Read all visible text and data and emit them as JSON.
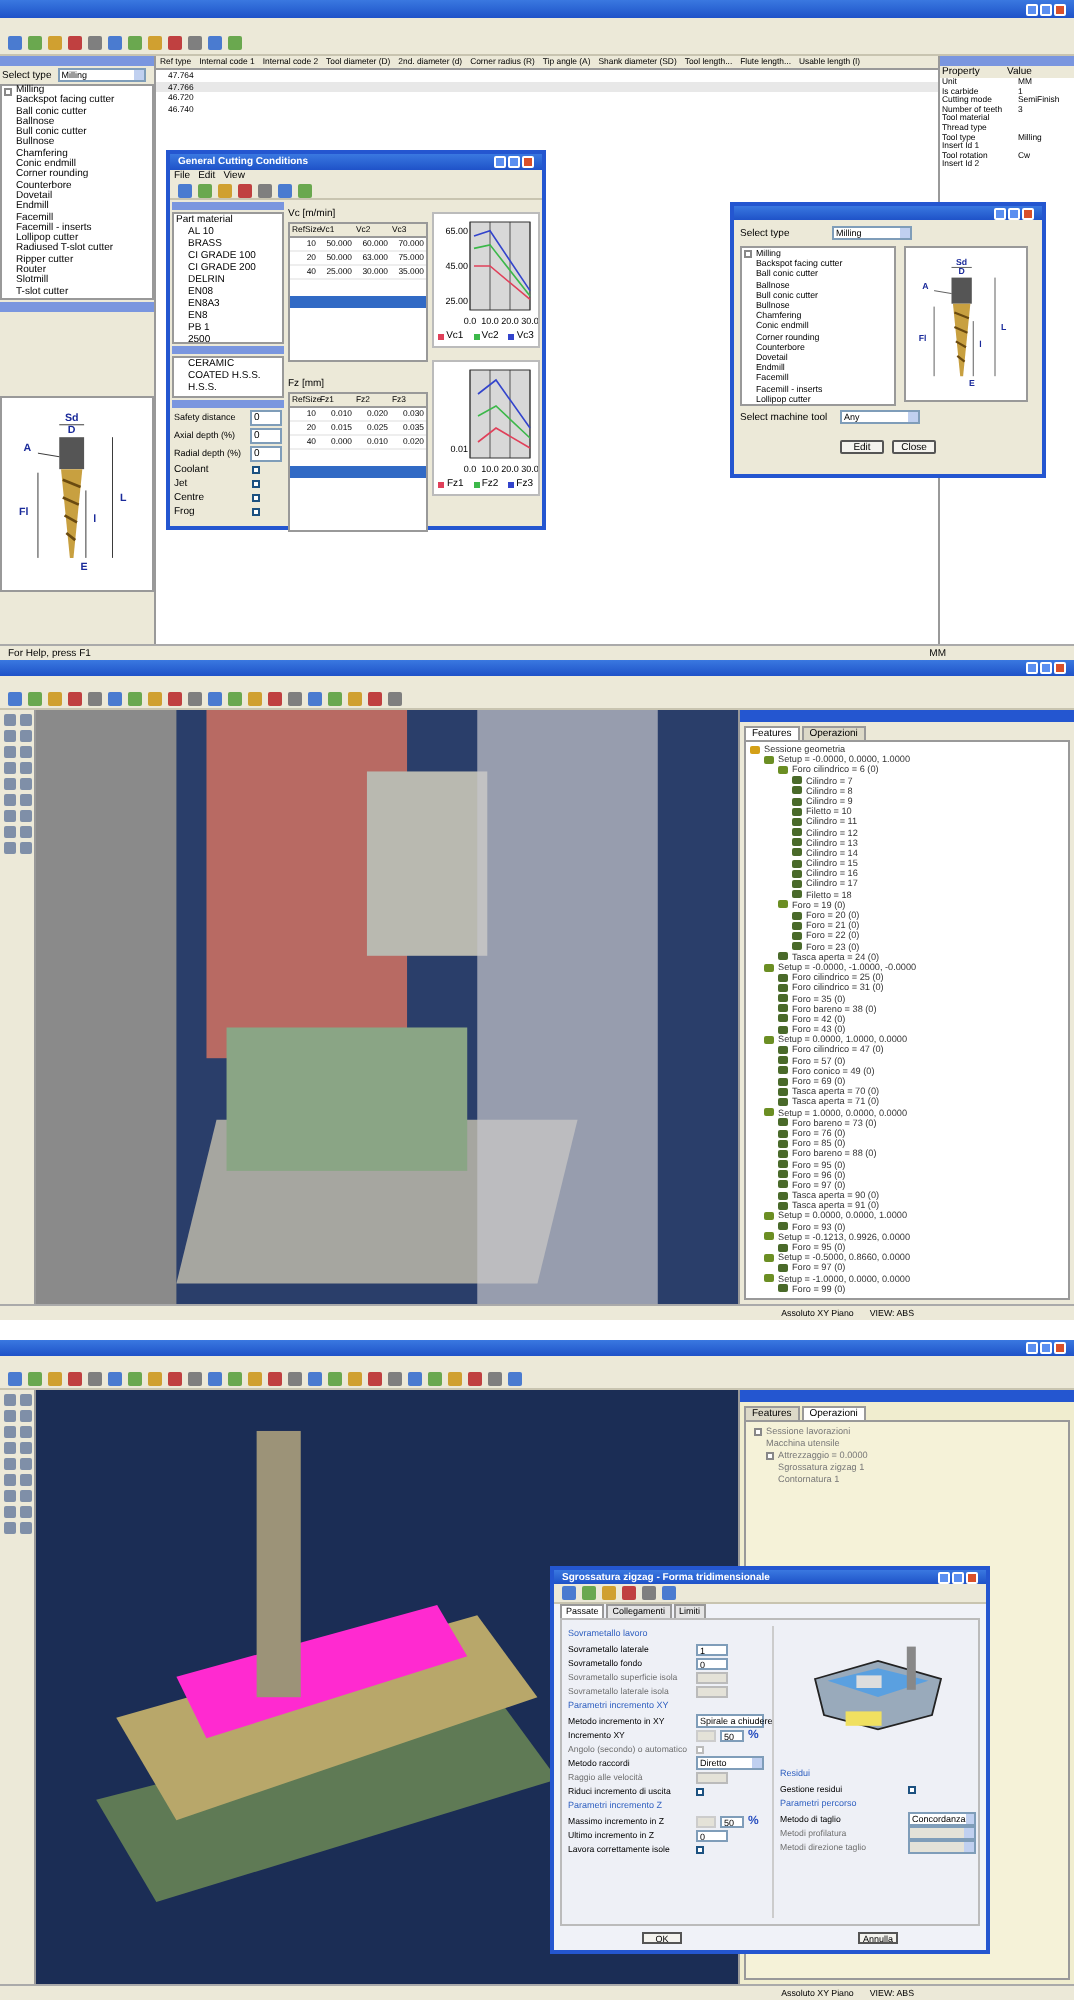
{
  "tool_database": {
    "select_type": {
      "label": "Select type",
      "value": "Milling"
    },
    "tool_types": [
      {
        "label": "Milling",
        "children": [
          {
            "label": "Backspot facing cutter"
          },
          {
            "label": "Ball conic cutter"
          },
          {
            "label": "Ballnose"
          },
          {
            "label": "Bull conic cutter"
          },
          {
            "label": "Bullnose"
          },
          {
            "label": "Chamfering"
          },
          {
            "label": "Conic endmill"
          },
          {
            "label": "Corner rounding"
          },
          {
            "label": "Counterbore"
          },
          {
            "label": "Dovetail"
          },
          {
            "label": "Endmill"
          },
          {
            "label": "Facemill"
          },
          {
            "label": "Facemill - inserts"
          },
          {
            "label": "Lollipop cutter"
          },
          {
            "label": "Radiused T-slot cutter"
          },
          {
            "label": "Ripper cutter"
          },
          {
            "label": "Router"
          },
          {
            "label": "Slotmill"
          },
          {
            "label": "T-slot cutter"
          }
        ]
      }
    ],
    "drawing_labels": [
      "Sd",
      "D",
      "A",
      "Fl",
      "l",
      "L",
      "E"
    ],
    "table": {
      "columns": [
        "Ref type",
        "Internal code 1",
        "Internal code 2",
        "Tool diameter (D)",
        "2nd. diameter (d)",
        "Corner radius (R)",
        "Tip angle (A)",
        "Shank diameter (SD)",
        "Tool length...",
        "Flute length...",
        "Usable length (l)"
      ],
      "rows": [
        {
          "cells": [
            "47.764"
          ],
          "selected": false
        },
        {
          "cells": [
            "47.766"
          ],
          "selected": true
        },
        {
          "cells": [
            "46.720"
          ],
          "selected": false
        },
        {
          "cells": [
            "46.740"
          ],
          "selected": false
        }
      ]
    },
    "properties": {
      "columns": [
        "Property",
        "Value"
      ],
      "rows": [
        [
          "Unit",
          "MM"
        ],
        [
          "Is carbide",
          "1"
        ],
        [
          "Cutting mode",
          "SemiFinish"
        ],
        [
          "Number of teeth",
          "3"
        ],
        [
          "Tool material"
        ],
        [
          "Thread type"
        ],
        [
          "Tool type",
          "Milling"
        ],
        [
          "Insert Id 1"
        ],
        [
          "Tool rotation",
          "Cw"
        ],
        [
          "Insert Id 2"
        ]
      ]
    },
    "status_bar": {
      "help": "For Help, press F1",
      "unit": "MM"
    },
    "cutting_dialog": {
      "title": "General Cutting Conditions",
      "menu": [
        "File",
        "Edit",
        "View"
      ],
      "part_material": {
        "label": "Part material",
        "items": [
          "AL 10",
          "BRASS",
          "CI GRADE 100",
          "CI GRADE 200",
          "DELRIN",
          "EN08",
          "EN8A3",
          "EN8",
          "PB 1",
          "2500"
        ]
      },
      "tool_material": [
        "CERAMIC",
        "COATED H.S.S.",
        "H.S.S."
      ],
      "fields": [
        {
          "label": "Safety distance",
          "value": "0"
        },
        {
          "label": "Axial depth (%)",
          "value": "0"
        },
        {
          "label": "Radial depth (%)",
          "value": "0"
        }
      ],
      "checks": [
        {
          "label": "Coolant",
          "checked": false
        },
        {
          "label": "Jet",
          "checked": false
        },
        {
          "label": "Centre",
          "checked": false
        },
        {
          "label": "Frog",
          "checked": false
        }
      ],
      "tables": [
        {
          "title": "Vc [m/min]",
          "columns": [
            "RefSize",
            "Vc1",
            "Vc2",
            "Vc3"
          ],
          "rows": [
            [
              "10",
              "50.000",
              "60.000",
              "70.000"
            ],
            [
              "20",
              "50.000",
              "63.000",
              "75.000"
            ],
            [
              "40",
              "25.000",
              "30.000",
              "35.000"
            ]
          ]
        },
        {
          "title": "Fz [mm]",
          "columns": [
            "RefSize",
            "Fz1",
            "Fz2",
            "Fz3"
          ],
          "rows": [
            [
              "10",
              "0.010",
              "0.020",
              "0.030"
            ],
            [
              "20",
              "0.015",
              "0.025",
              "0.035"
            ],
            [
              "40",
              "0.000",
              "0.010",
              "0.020"
            ]
          ]
        }
      ],
      "charts": [
        {
          "chart_data": {
            "type": "line",
            "legend": "bottom",
            "x": [
              2,
              10,
              30
            ],
            "xlim": [
              0,
              30
            ],
            "ylim": [
              20,
              70
            ],
            "xticks": [
              {
                "value": 0,
                "label": "0.0"
              },
              {
                "value": 10,
                "label": "10.0"
              },
              {
                "value": 20,
                "label": "20.0"
              },
              {
                "value": 30,
                "label": "30.0"
              }
            ],
            "yticks": [
              {
                "value": 65,
                "label": "65.00"
              },
              {
                "value": 45,
                "label": "45.00"
              },
              {
                "value": 25,
                "label": "25.00"
              }
            ],
            "series": [
              {
                "name": "Vc1",
                "color": "#e0405a",
                "values": [
                  45,
                  45,
                  26
                ]
              },
              {
                "name": "Vc2",
                "color": "#3cb84a",
                "values": [
                  55,
                  57,
                  28
                ]
              },
              {
                "name": "Vc3",
                "color": "#3344cc",
                "values": [
                  62,
                  65,
                  31
                ]
              }
            ]
          }
        }
      ],
      "fz_chart": {
        "x_labels": [
          "0.0",
          "10.0",
          "20.0",
          "30.0"
        ],
        "y_label": "0.01",
        "legend": [
          {
            "name": "Fz1",
            "color": "#e0405a"
          },
          {
            "name": "Fz2",
            "color": "#3cb84a"
          },
          {
            "name": "Fz3",
            "color": "#3344cc"
          }
        ]
      }
    },
    "search_dialog": {
      "select_type": {
        "label": "Select type",
        "value": "Milling"
      },
      "tool_types": [
        {
          "label": "Milling",
          "children": [
            {
              "label": "Backspot facing cutter"
            },
            {
              "label": "Ball conic cutter"
            },
            {
              "label": "Ballnose"
            },
            {
              "label": "Bull conic cutter"
            },
            {
              "label": "Bullnose"
            },
            {
              "label": "Chamfering"
            },
            {
              "label": "Conic endmill"
            },
            {
              "label": "Corner rounding"
            },
            {
              "label": "Counterbore"
            },
            {
              "label": "Dovetail"
            },
            {
              "label": "Endmill"
            },
            {
              "label": "Facemill"
            },
            {
              "label": "Facemill - inserts"
            },
            {
              "label": "Lollipop cutter"
            }
          ]
        }
      ],
      "drawing_labels": [
        "Sd",
        "D",
        "A",
        "Fl",
        "l",
        "L",
        "E"
      ],
      "machine": {
        "label": "Select machine tool",
        "value": "Any"
      },
      "buttons": [
        "Edit",
        "Close"
      ]
    }
  },
  "cam_features": {
    "navigator": {
      "tabs": [
        {
          "label": "Features",
          "selected": true
        },
        {
          "label": "Operazioni",
          "selected": false
        }
      ],
      "tree": [
        {
          "label": "Sessione geometria",
          "children": [
            {
              "label": "Setup = -0.0000, 0.0000, 1.0000",
              "children": [
                {
                  "label": "Foro cilindrico = 6 (0)",
                  "children": [
                    {
                      "label": "Cilindro = 7"
                    },
                    {
                      "label": "Cilindro = 8"
                    },
                    {
                      "label": "Cilindro = 9"
                    },
                    {
                      "label": "Filetto = 10"
                    },
                    {
                      "label": "Cilindro = 11"
                    },
                    {
                      "label": "Cilindro = 12"
                    },
                    {
                      "label": "Cilindro = 13"
                    },
                    {
                      "label": "Cilindro = 14"
                    },
                    {
                      "label": "Cilindro = 15"
                    },
                    {
                      "label": "Cilindro = 16"
                    },
                    {
                      "label": "Cilindro = 17"
                    },
                    {
                      "label": "Filetto = 18"
                    }
                  ]
                },
                {
                  "label": "Foro = 19 (0)",
                  "children": [
                    {
                      "label": "Foro = 20 (0)"
                    },
                    {
                      "label": "Foro = 21 (0)"
                    },
                    {
                      "label": "Foro = 22 (0)"
                    },
                    {
                      "label": "Foro = 23 (0)"
                    }
                  ]
                },
                {
                  "label": "Tasca aperta = 24 (0)"
                }
              ]
            },
            {
              "label": "Setup = -0.0000, -1.0000, -0.0000",
              "children": [
                {
                  "label": "Foro cilindrico = 25 (0)"
                },
                {
                  "label": "Foro cilindrico = 31 (0)"
                },
                {
                  "label": "Foro = 35 (0)"
                },
                {
                  "label": "Foro bareno = 38 (0)"
                },
                {
                  "label": "Foro = 42 (0)"
                },
                {
                  "label": "Foro = 43 (0)"
                }
              ]
            },
            {
              "label": "Setup = 0.0000, 1.0000, 0.0000",
              "children": [
                {
                  "label": "Foro cilindrico = 47 (0)"
                },
                {
                  "label": "Foro = 57 (0)"
                },
                {
                  "label": "Foro conico = 49 (0)"
                },
                {
                  "label": "Foro = 69 (0)"
                },
                {
                  "label": "Tasca aperta = 70 (0)"
                },
                {
                  "label": "Tasca aperta = 71 (0)"
                }
              ]
            },
            {
              "label": "Setup = 1.0000, 0.0000, 0.0000",
              "children": [
                {
                  "label": "Foro bareno = 73 (0)"
                },
                {
                  "label": "Foro = 76 (0)"
                },
                {
                  "label": "Foro = 85 (0)"
                },
                {
                  "label": "Foro bareno = 88 (0)"
                },
                {
                  "label": "Foro = 95 (0)"
                },
                {
                  "label": "Foro = 96 (0)"
                },
                {
                  "label": "Foro = 97 (0)"
                },
                {
                  "label": "Tasca aperta = 90 (0)"
                },
                {
                  "label": "Tasca aperta = 91 (0)"
                }
              ]
            },
            {
              "label": "Setup = 0.0000, 0.0000, 1.0000",
              "children": [
                {
                  "label": "Foro = 93 (0)"
                }
              ]
            },
            {
              "label": "Setup = -0.1213, 0.9926, 0.0000",
              "children": [
                {
                  "label": "Foro = 95 (0)"
                }
              ]
            },
            {
              "label": "Setup = -0.5000, 0.8660, 0.0000",
              "children": [
                {
                  "label": "Foro = 97 (0)"
                }
              ]
            },
            {
              "label": "Setup = -1.0000, 0.0000, 0.0000",
              "children": [
                {
                  "label": "Foro = 99 (0)"
                }
              ]
            }
          ]
        }
      ]
    },
    "status_bar": [
      "Assoluto XY Piano",
      "VIEW: ABS"
    ]
  },
  "cam_operations": {
    "navigator": {
      "tabs": [
        {
          "label": "Features",
          "selected": false
        },
        {
          "label": "Operazioni",
          "selected": true
        }
      ],
      "tree": [
        {
          "label": "Sessione lavorazioni",
          "children": [
            {
              "label": "Macchina utensile"
            },
            {
              "label": "Attrezzaggio = 0.0000",
              "children": [
                {
                  "label": "Sgrossatura zigzag 1"
                },
                {
                  "label": "Contornatura 1"
                }
              ]
            }
          ]
        }
      ]
    },
    "dialog": {
      "title": "Sgrossatura zigzag - Forma tridimensionale",
      "tabs": [
        {
          "label": "Passate",
          "selected": true
        },
        {
          "label": "Collegamenti",
          "selected": false
        },
        {
          "label": "Limiti",
          "selected": false
        }
      ],
      "left": [
        {
          "kind": "section",
          "label": "Sovrametallo lavoro"
        },
        {
          "kind": "spin",
          "label": "Sovrametallo laterale",
          "value": "1",
          "disabled": false
        },
        {
          "kind": "spin",
          "label": "Sovrametallo fondo",
          "value": "0",
          "disabled": false
        },
        {
          "kind": "spin",
          "label": "Sovrametallo superficie isola",
          "disabled": true
        },
        {
          "kind": "spin",
          "label": "Sovrametallo laterale isola",
          "disabled": true
        },
        {
          "kind": "section",
          "label": "Parametri incremento XY"
        },
        {
          "kind": "select",
          "label": "Metodo incremento in XY",
          "value": "Spirale a chiudere",
          "disabled": false
        },
        {
          "kind": "percent",
          "label": "Incremento XY",
          "value": "50",
          "unit": "%",
          "disabled": false
        },
        {
          "kind": "check",
          "label": "Angolo (secondo) o automatico",
          "checked": false,
          "disabled": true
        },
        {
          "kind": "select",
          "label": "Metodo raccordi",
          "value": "Diretto",
          "disabled": false
        },
        {
          "kind": "spin",
          "label": "Raggio alle velocità",
          "disabled": true
        },
        {
          "kind": "check",
          "label": "Riduci incremento di uscita",
          "checked": false,
          "disabled": false
        },
        {
          "kind": "section",
          "label": "Parametri incremento Z"
        },
        {
          "kind": "percent",
          "label": "Massimo incremento in Z",
          "value": "50",
          "unit": "%",
          "disabled": false
        },
        {
          "kind": "spin",
          "label": "Ultimo incremento in Z",
          "value": "0",
          "disabled": false
        },
        {
          "kind": "check",
          "label": "Lavora correttamente isole",
          "checked": false,
          "disabled": false
        }
      ],
      "right": [
        {
          "kind": "section",
          "label": "Residui"
        },
        {
          "kind": "check",
          "label": "Gestione residui",
          "checked": false,
          "disabled": false
        },
        {
          "kind": "section",
          "label": "Parametri percorso"
        },
        {
          "kind": "select",
          "label": "Metodo di taglio",
          "value": "Concordanza",
          "disabled": false
        },
        {
          "kind": "select",
          "label": "Metodi profilatura",
          "disabled": true
        },
        {
          "kind": "select",
          "label": "Metodi direzione taglio",
          "disabled": true
        }
      ],
      "buttons": [
        "OK",
        "Annulla"
      ]
    },
    "status_bar": [
      "Assoluto XY Piano",
      "VIEW: ABS"
    ]
  }
}
